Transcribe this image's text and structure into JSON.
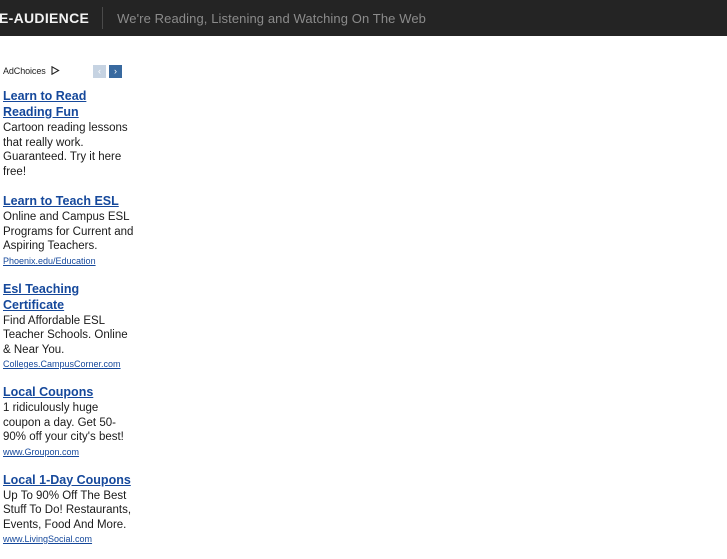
{
  "header": {
    "title": "E-AUDIENCE",
    "tagline": "We're Reading, Listening and Watching On The Web"
  },
  "ads": {
    "adchoices_label": "AdChoices",
    "adchoices_icon": "adchoices-triangle-icon",
    "prev_label": "‹",
    "next_label": "›",
    "colors": {
      "link": "#15489b",
      "header_bg": "#242424",
      "tagline": "#8b8b8b",
      "nav_prev": "#c6d3e2",
      "nav_next": "#38699f"
    },
    "items": [
      {
        "title": "Learn to Read Reading Fun",
        "description": "Cartoon reading lessons that really work. Guaranteed. Try it here free!",
        "url": ""
      },
      {
        "title": "Learn to Teach ESL",
        "description": "Online and Campus ESL Programs for Current and Aspiring Teachers.",
        "url": "Phoenix.edu/Education"
      },
      {
        "title": "Esl Teaching Certificate",
        "description": "Find Affordable ESL Teacher Schools. Online & Near You.",
        "url": "Colleges.CampusCorner.com"
      },
      {
        "title": "Local Coupons",
        "description": "1 ridiculously huge coupon a day. Get 50-90% off your city's best!",
        "url": "www.Groupon.com"
      },
      {
        "title": "Local 1-Day Coupons",
        "description": "Up To 90% Off The Best Stuff To Do! Restaurants, Events, Food And More.",
        "url": "www.LivingSocial.com"
      }
    ]
  }
}
